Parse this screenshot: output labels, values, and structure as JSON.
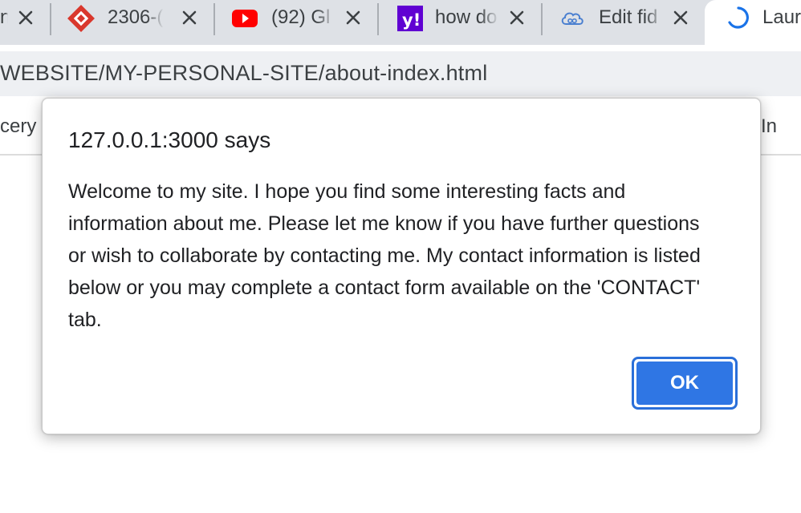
{
  "tabs": [
    {
      "title": "n",
      "favicon": "generic-icon"
    },
    {
      "title": "2306-(",
      "favicon": "diamond-logo-icon"
    },
    {
      "title": "(92) Gl",
      "favicon": "youtube-icon"
    },
    {
      "title": "how do",
      "favicon": "yahoo-icon"
    },
    {
      "title": "Edit fid",
      "favicon": "cloud-icon"
    }
  ],
  "active_tab": {
    "title": "Laur",
    "favicon": "loading-spinner-icon"
  },
  "address_bar": {
    "url": "WEBSITE/MY-PERSONAL-SITE/about-index.html"
  },
  "bookmarks": {
    "left_label": "cery",
    "right_label": "In"
  },
  "dialog": {
    "heading": "127.0.0.1:3000 says",
    "message": "Welcome to my site. I hope you find some interesting facts and information about me. Please let me know if you have further questions or wish to collaborate by contacting me. My contact information is listed below or you may complete a contact form available on the 'CONTACT' tab.",
    "ok_label": "OK"
  },
  "colors": {
    "ok_button": "#2f76e4",
    "tabstrip": "#dee1e6",
    "youtube_red": "#ff0000",
    "yahoo_purple": "#6001d2",
    "spinner_blue": "#1a73e8"
  }
}
